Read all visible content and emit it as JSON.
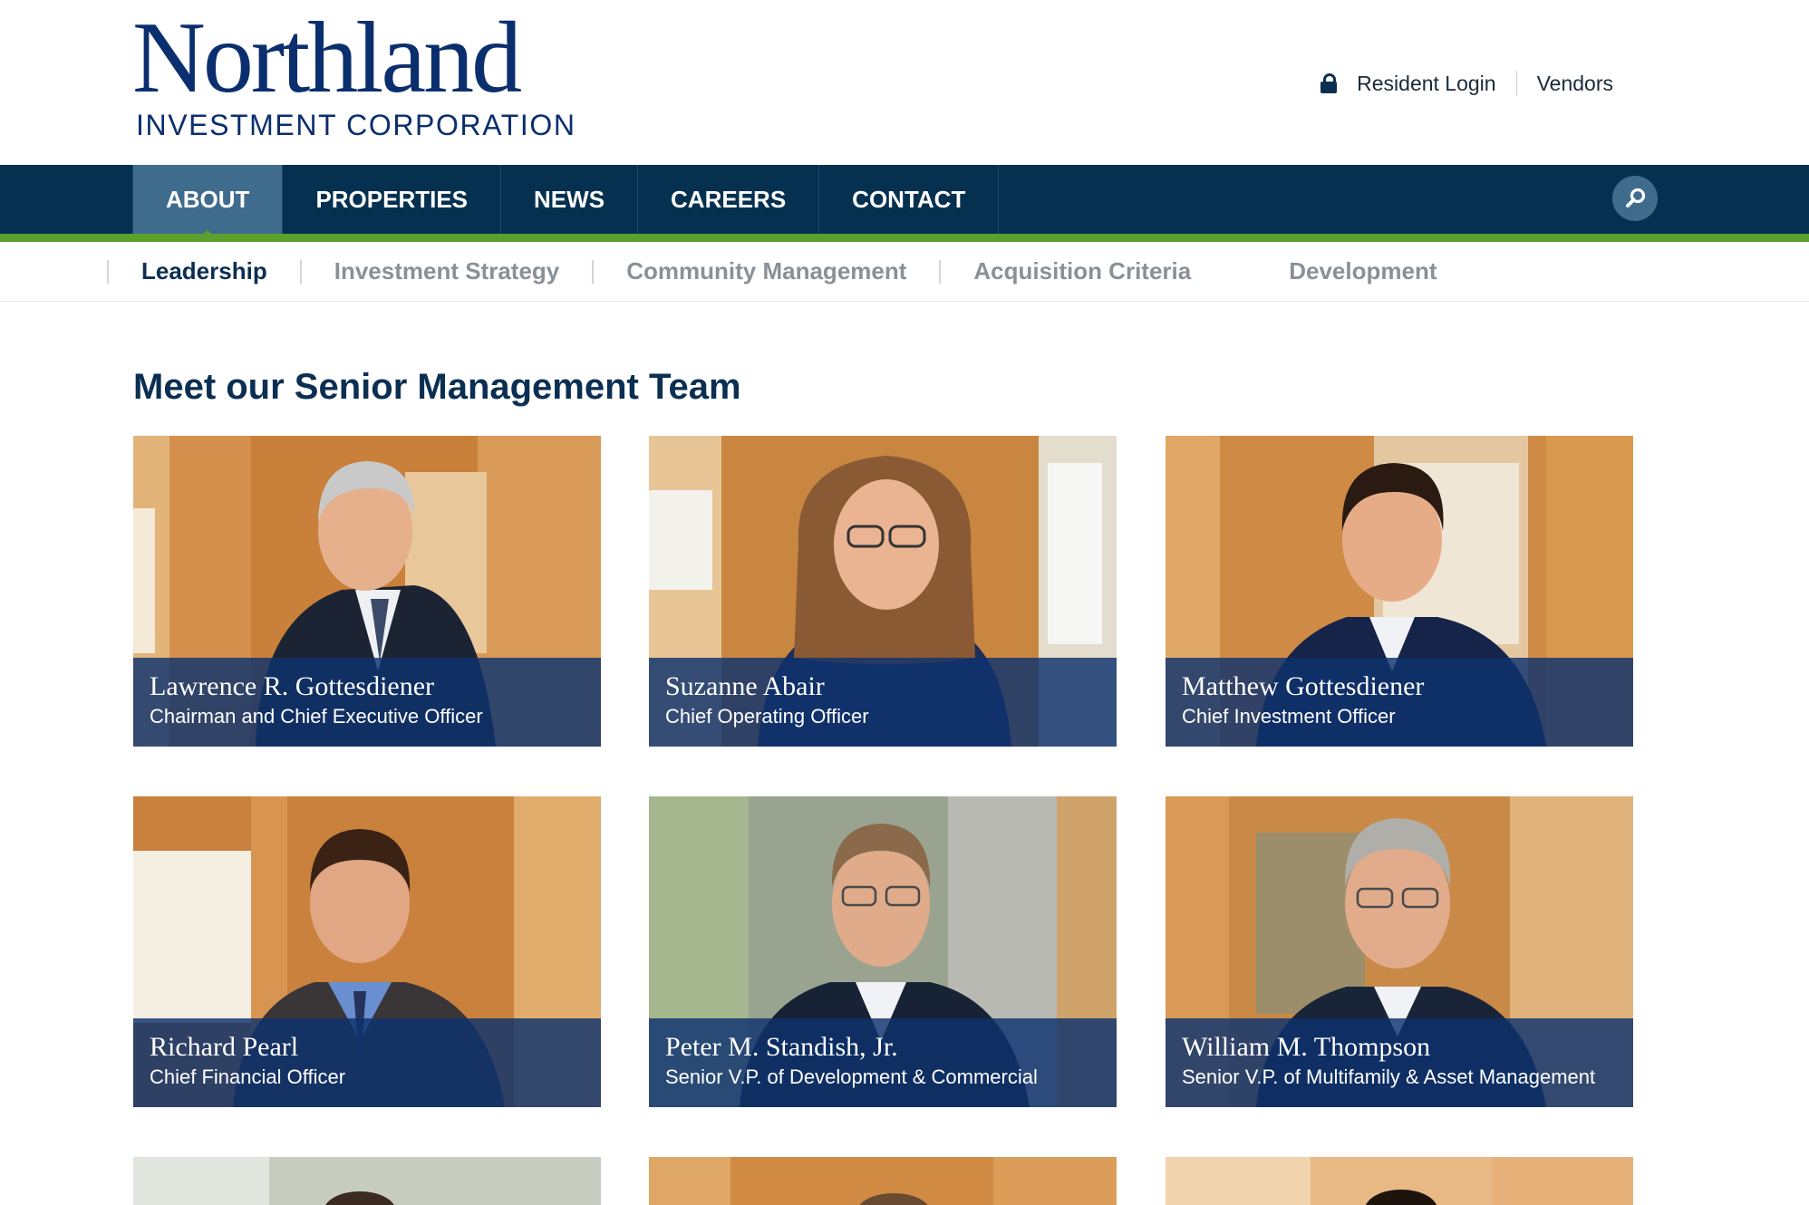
{
  "brand": {
    "name": "Northland",
    "subtitle": "INVESTMENT CORPORATION",
    "color": "#0b2f6e"
  },
  "utility": {
    "lock_icon": "lock-icon",
    "resident_login": "Resident Login",
    "vendors": "Vendors"
  },
  "nav": {
    "items": [
      {
        "label": "ABOUT",
        "active": true
      },
      {
        "label": "PROPERTIES"
      },
      {
        "label": "NEWS"
      },
      {
        "label": "CAREERS"
      },
      {
        "label": "CONTACT"
      }
    ],
    "search_icon": "search-icon",
    "bar_color": "#053050",
    "active_color": "#3f6c8d",
    "accent_color": "#5aa02c"
  },
  "subnav": {
    "items": [
      {
        "label": "Leadership",
        "active": true
      },
      {
        "label": "Investment Strategy"
      },
      {
        "label": "Community Management"
      },
      {
        "label": "Acquisition Criteria"
      },
      {
        "label": "Development"
      }
    ]
  },
  "main": {
    "title": "Meet our Senior Management Team",
    "team": [
      {
        "name": "Lawrence R. Gottesdiener",
        "role": "Chairman and Chief Executive Officer"
      },
      {
        "name": "Suzanne Abair",
        "role": "Chief Operating Officer"
      },
      {
        "name": "Matthew Gottesdiener",
        "role": "Chief Investment Officer"
      },
      {
        "name": "Richard Pearl",
        "role": "Chief Financial Officer"
      },
      {
        "name": "Peter M. Standish, Jr.",
        "role": "Senior V.P. of Development & Commercial"
      },
      {
        "name": "William M. Thompson",
        "role": "Senior V.P. of Multifamily & Asset Management"
      }
    ]
  }
}
